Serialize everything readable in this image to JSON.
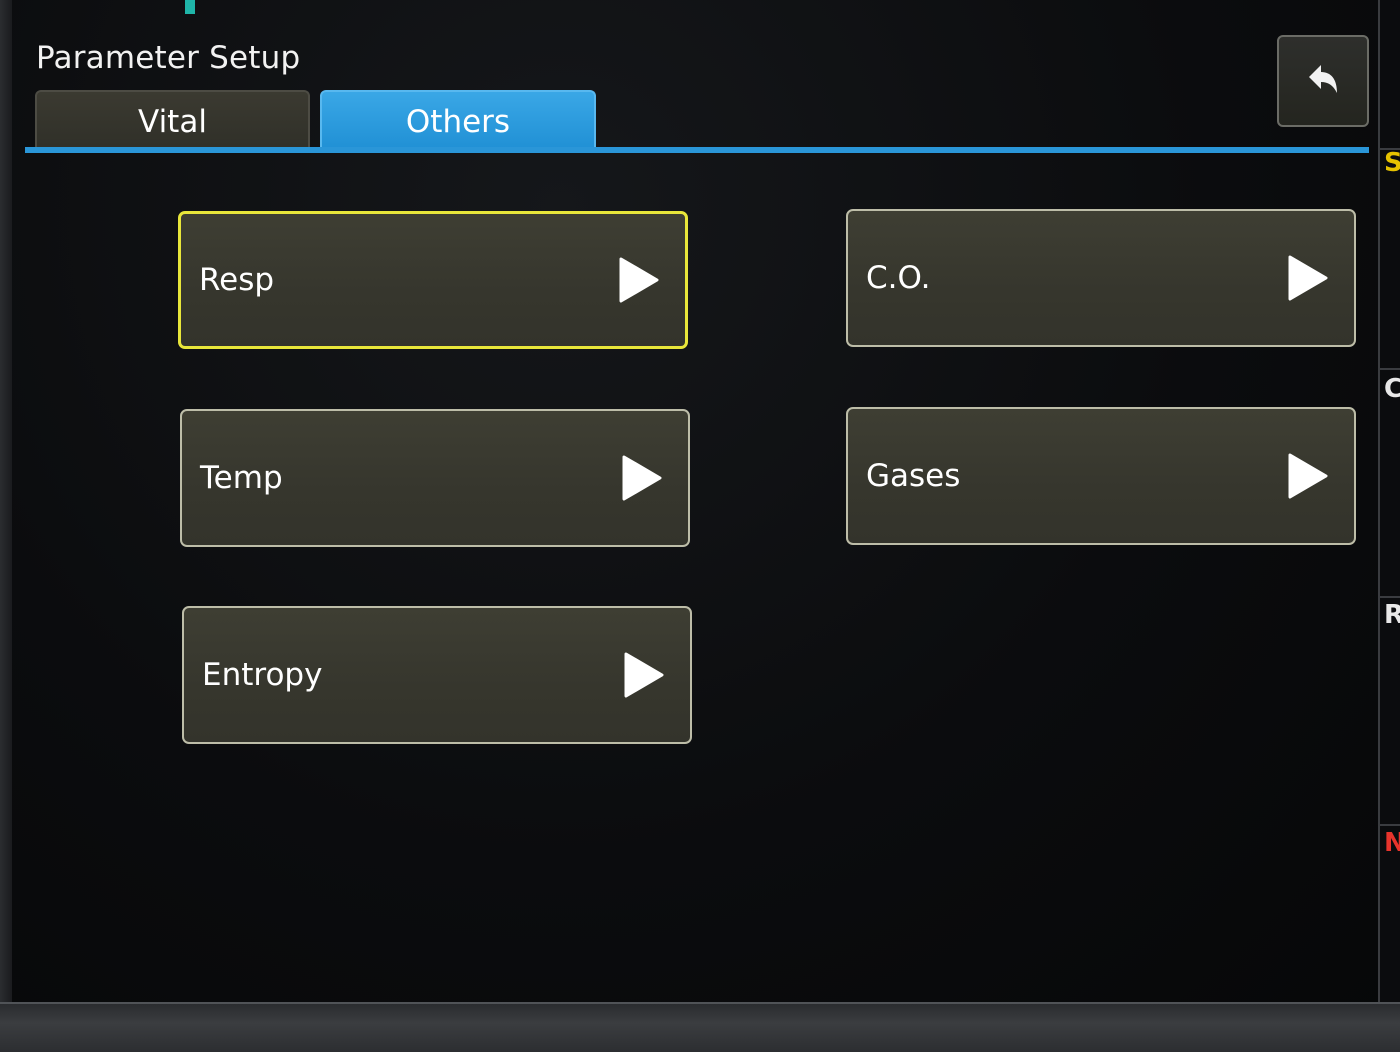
{
  "header": {
    "title": "Parameter Setup"
  },
  "tabs": [
    {
      "label": "Vital",
      "active": false
    },
    {
      "label": "Others",
      "active": true
    }
  ],
  "back_button": {
    "icon": "back-arrow-icon"
  },
  "parameters": [
    {
      "label": "Resp",
      "selected": true,
      "icon": "arrow-right-icon"
    },
    {
      "label": "C.O.",
      "selected": false,
      "icon": "arrow-right-icon"
    },
    {
      "label": "Temp",
      "selected": false,
      "icon": "arrow-right-icon"
    },
    {
      "label": "Gases",
      "selected": false,
      "icon": "arrow-right-icon"
    },
    {
      "label": "Entropy",
      "selected": false,
      "icon": "arrow-right-icon"
    }
  ],
  "side_panel": {
    "letters": [
      {
        "text": "S",
        "color": "#e6c200"
      },
      {
        "text": "C",
        "color": "#e8e8e8"
      },
      {
        "text": "R",
        "color": "#e8e8e8"
      },
      {
        "text": "N",
        "color": "#e8342c"
      }
    ]
  },
  "colors": {
    "accent_tab": "#2a96d8",
    "selection_outline": "#e8e63a",
    "button_fill": "#3a3a30"
  }
}
